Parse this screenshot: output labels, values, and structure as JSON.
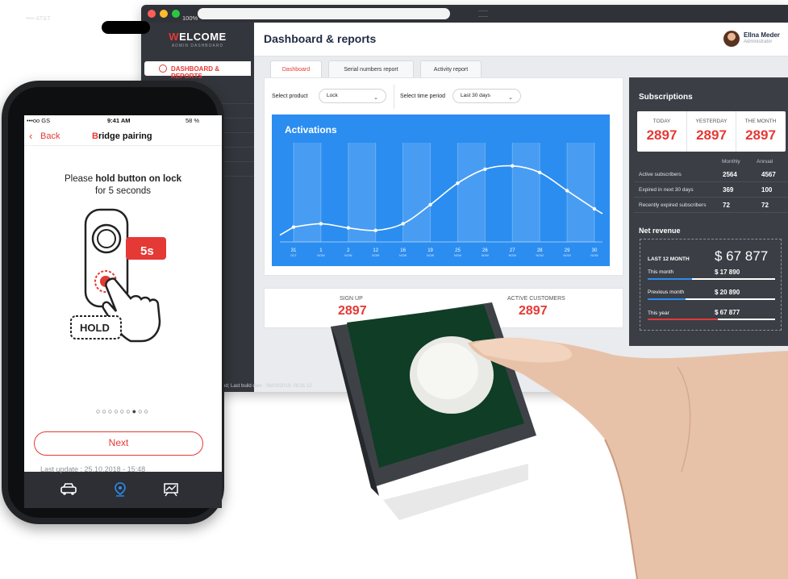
{
  "sidebar": {
    "logo_accent": "W",
    "logo_rest": "ELCOME",
    "logo_sub": "ADMIN DASHBOARD",
    "active_item": "DASHBOARD & REPORTS",
    "footer": "rved; Last build date : 06/03/2019, 08:31:12"
  },
  "header": {
    "title": "Dashboard & reports",
    "user_name": "Ellna Meder",
    "user_role": "Administrator"
  },
  "tabs": [
    "Dashboard",
    "Serial numbers report",
    "Activity report"
  ],
  "filters": {
    "product_label": "Select product",
    "product_value": "Lock",
    "period_label": "Select time period",
    "period_value": "Last 30 days"
  },
  "chart_data": {
    "type": "line",
    "title": "Activations",
    "categories": [
      {
        "day": "31",
        "month": "OCT"
      },
      {
        "day": "1",
        "month": "NOW"
      },
      {
        "day": "2",
        "month": "NOW"
      },
      {
        "day": "12",
        "month": "NOW"
      },
      {
        "day": "16",
        "month": "NOW"
      },
      {
        "day": "19",
        "month": "NOW"
      },
      {
        "day": "25",
        "month": "NOW"
      },
      {
        "day": "26",
        "month": "NOW"
      },
      {
        "day": "27",
        "month": "NOW"
      },
      {
        "day": "28",
        "month": "NOW"
      },
      {
        "day": "29",
        "month": "NOW"
      },
      {
        "day": "30",
        "month": "NOW"
      }
    ],
    "values": [
      18,
      22,
      17,
      14,
      22,
      45,
      71,
      88,
      92,
      84,
      62,
      40
    ],
    "ylim": [
      0,
      120
    ],
    "grid": true,
    "highlight_bands": true
  },
  "stats": {
    "signup_label": "SIGN UP",
    "signup_value": "2897",
    "active_label": "ACTIVE CUSTOMERS",
    "active_value": "2897"
  },
  "subscriptions": {
    "title": "Subscriptions",
    "today_label": "TODAY",
    "today_value": "2897",
    "yesterday_label": "YESTERDAY",
    "yesterday_value": "2897",
    "month_label": "THE MONTH",
    "month_value": "2897",
    "col_monthly": "Monthly",
    "col_annual": "Annual",
    "rows": [
      {
        "name": "Active subscribers",
        "monthly": "2564",
        "annual": "4567"
      },
      {
        "name": "Expired in next 30 days",
        "monthly": "369",
        "annual": "100"
      },
      {
        "name": "Recently expired subscribers",
        "monthly": "72",
        "annual": "72"
      }
    ]
  },
  "revenue": {
    "title": "Net revenue",
    "last12_label": "LAST 12 MONTH",
    "last12_value": "$ 67 877",
    "items": [
      {
        "label": "This month",
        "value": "$ 17 890",
        "progress": 0.35,
        "color": "#2b8df0"
      },
      {
        "label": "Previous month",
        "value": "$ 20 890",
        "progress": 0.3,
        "color": "#2b8df0"
      },
      {
        "label": "This year",
        "value": "$ 67 877",
        "progress": 0.55,
        "color": "#e53935"
      }
    ]
  },
  "phone": {
    "outer_carrier": "•••• AT&T",
    "outer_battery": "100%",
    "carrier": "•••oo GS",
    "time": "9:41 AM",
    "battery": "58 %",
    "back_label": "Back",
    "title_accent": "B",
    "title_rest": "ridge pairing",
    "instruction_pre": "Please ",
    "instruction_bold": "hold button on lock",
    "instruction_line2": "for 5 seconds",
    "badge": "5s",
    "hold_label": "HOLD",
    "pager": "○○○○○○●○○",
    "next_label": "Next",
    "last_update": "Last update : 25.10.2018 - 15:48"
  },
  "colors": {
    "accent": "#e53935",
    "chart_blue": "#2b8df0",
    "panel_dark": "#3b3e45"
  }
}
